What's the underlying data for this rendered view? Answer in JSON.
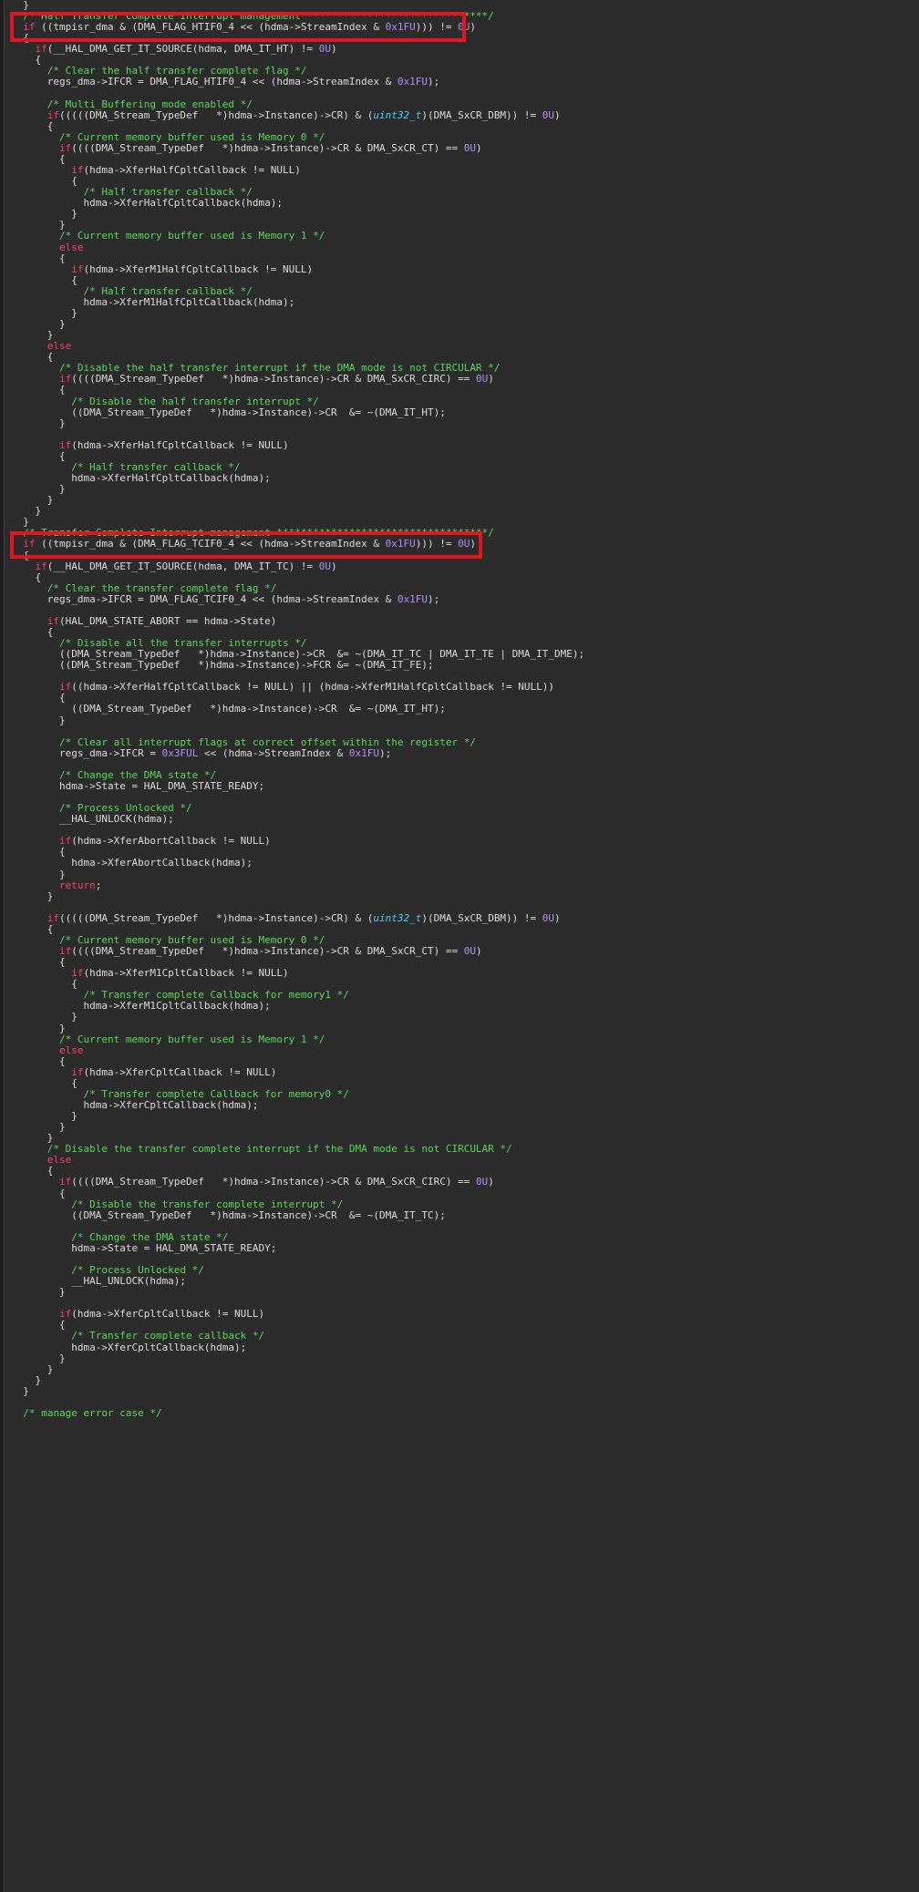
{
  "editor": {
    "highlight_color": "#e0151f",
    "colors": {
      "comment": "#57d957",
      "keyword": "#ff3b6b",
      "number": "#b48cf7",
      "type": "#4fc6ff",
      "default": "#dcdcdc",
      "background": "#2b2b2b"
    },
    "lines": [
      [
        [
          "d",
          "  }"
        ]
      ],
      [
        [
          "c",
          "  /* Half Transfer Complete Interrupt management ******************************/"
        ]
      ],
      [
        [
          "k",
          "  if"
        ],
        [
          "d",
          " ((tmpisr_dma & (DMA_FLAG_HTIF0_4 << (hdma->StreamIndex & "
        ],
        [
          "n",
          "0x1FU"
        ],
        [
          "d",
          "))) != "
        ],
        [
          "n",
          "0U"
        ],
        [
          "d",
          ")"
        ]
      ],
      [
        [
          "d",
          "  {"
        ]
      ],
      [
        [
          "k",
          "    if"
        ],
        [
          "d",
          "(__HAL_DMA_GET_IT_SOURCE(hdma, DMA_IT_HT) != "
        ],
        [
          "n",
          "0U"
        ],
        [
          "d",
          ")"
        ]
      ],
      [
        [
          "d",
          "    {"
        ]
      ],
      [
        [
          "c",
          "      /* Clear the half transfer complete flag */"
        ]
      ],
      [
        [
          "d",
          "      regs_dma->IFCR = DMA_FLAG_HTIF0_4 << (hdma->StreamIndex & "
        ],
        [
          "n",
          "0x1FU"
        ],
        [
          "d",
          ");"
        ]
      ],
      [],
      [
        [
          "c",
          "      /* Multi_Buffering mode enabled */"
        ]
      ],
      [
        [
          "k",
          "      if"
        ],
        [
          "d",
          "(((((DMA_Stream_TypeDef   *)hdma->Instance)->CR) & ("
        ],
        [
          "t",
          "uint32_t"
        ],
        [
          "d",
          ")(DMA_SxCR_DBM)) != "
        ],
        [
          "n",
          "0U"
        ],
        [
          "d",
          ")"
        ]
      ],
      [
        [
          "d",
          "      {"
        ]
      ],
      [
        [
          "c",
          "        /* Current memory buffer used is Memory 0 */"
        ]
      ],
      [
        [
          "k",
          "        if"
        ],
        [
          "d",
          "((((DMA_Stream_TypeDef   *)hdma->Instance)->CR & DMA_SxCR_CT) == "
        ],
        [
          "n",
          "0U"
        ],
        [
          "d",
          ")"
        ]
      ],
      [
        [
          "d",
          "        {"
        ]
      ],
      [
        [
          "k",
          "          if"
        ],
        [
          "d",
          "(hdma->XferHalfCpltCallback != NULL)"
        ]
      ],
      [
        [
          "d",
          "          {"
        ]
      ],
      [
        [
          "c",
          "            /* Half transfer callback */"
        ]
      ],
      [
        [
          "d",
          "            hdma->XferHalfCpltCallback(hdma);"
        ]
      ],
      [
        [
          "d",
          "          }"
        ]
      ],
      [
        [
          "d",
          "        }"
        ]
      ],
      [
        [
          "c",
          "        /* Current memory buffer used is Memory 1 */"
        ]
      ],
      [
        [
          "k",
          "        else"
        ]
      ],
      [
        [
          "d",
          "        {"
        ]
      ],
      [
        [
          "k",
          "          if"
        ],
        [
          "d",
          "(hdma->XferM1HalfCpltCallback != NULL)"
        ]
      ],
      [
        [
          "d",
          "          {"
        ]
      ],
      [
        [
          "c",
          "            /* Half transfer callback */"
        ]
      ],
      [
        [
          "d",
          "            hdma->XferM1HalfCpltCallback(hdma);"
        ]
      ],
      [
        [
          "d",
          "          }"
        ]
      ],
      [
        [
          "d",
          "        }"
        ]
      ],
      [
        [
          "d",
          "      }"
        ]
      ],
      [
        [
          "k",
          "      else"
        ]
      ],
      [
        [
          "d",
          "      {"
        ]
      ],
      [
        [
          "c",
          "        /* Disable the half transfer interrupt if the DMA mode is not CIRCULAR */"
        ]
      ],
      [
        [
          "k",
          "        if"
        ],
        [
          "d",
          "((((DMA_Stream_TypeDef   *)hdma->Instance)->CR & DMA_SxCR_CIRC) == "
        ],
        [
          "n",
          "0U"
        ],
        [
          "d",
          ")"
        ]
      ],
      [
        [
          "d",
          "        {"
        ]
      ],
      [
        [
          "c",
          "          /* Disable the half transfer interrupt */"
        ]
      ],
      [
        [
          "d",
          "          ((DMA_Stream_TypeDef   *)hdma->Instance)->CR  &= ~(DMA_IT_HT);"
        ]
      ],
      [
        [
          "d",
          "        }"
        ]
      ],
      [],
      [
        [
          "k",
          "        if"
        ],
        [
          "d",
          "(hdma->XferHalfCpltCallback != NULL)"
        ]
      ],
      [
        [
          "d",
          "        {"
        ]
      ],
      [
        [
          "c",
          "          /* Half transfer callback */"
        ]
      ],
      [
        [
          "d",
          "          hdma->XferHalfCpltCallback(hdma);"
        ]
      ],
      [
        [
          "d",
          "        }"
        ]
      ],
      [
        [
          "d",
          "      }"
        ]
      ],
      [
        [
          "d",
          "    }"
        ]
      ],
      [
        [
          "d",
          "  }"
        ]
      ],
      [
        [
          "c",
          "  /* Transfer Complete Interrupt management ***********************************/"
        ]
      ],
      [
        [
          "k",
          "  if"
        ],
        [
          "d",
          " ((tmpisr_dma & (DMA_FLAG_TCIF0_4 << (hdma->StreamIndex & "
        ],
        [
          "n",
          "0x1FU"
        ],
        [
          "d",
          "))) != "
        ],
        [
          "n",
          "0U"
        ],
        [
          "d",
          ")"
        ]
      ],
      [
        [
          "d",
          "  {"
        ]
      ],
      [
        [
          "k",
          "    if"
        ],
        [
          "d",
          "(__HAL_DMA_GET_IT_SOURCE(hdma, DMA_IT_TC) != "
        ],
        [
          "n",
          "0U"
        ],
        [
          "d",
          ")"
        ]
      ],
      [
        [
          "d",
          "    {"
        ]
      ],
      [
        [
          "c",
          "      /* Clear the transfer complete flag */"
        ]
      ],
      [
        [
          "d",
          "      regs_dma->IFCR = DMA_FLAG_TCIF0_4 << (hdma->StreamIndex & "
        ],
        [
          "n",
          "0x1FU"
        ],
        [
          "d",
          ");"
        ]
      ],
      [],
      [
        [
          "k",
          "      if"
        ],
        [
          "d",
          "(HAL_DMA_STATE_ABORT == hdma->State)"
        ]
      ],
      [
        [
          "d",
          "      {"
        ]
      ],
      [
        [
          "c",
          "        /* Disable all the transfer interrupts */"
        ]
      ],
      [
        [
          "d",
          "        ((DMA_Stream_TypeDef   *)hdma->Instance)->CR  &= ~(DMA_IT_TC | DMA_IT_TE | DMA_IT_DME);"
        ]
      ],
      [
        [
          "d",
          "        ((DMA_Stream_TypeDef   *)hdma->Instance)->FCR &= ~(DMA_IT_FE);"
        ]
      ],
      [],
      [
        [
          "k",
          "        if"
        ],
        [
          "d",
          "((hdma->XferHalfCpltCallback != NULL) || (hdma->XferM1HalfCpltCallback != NULL))"
        ]
      ],
      [
        [
          "d",
          "        {"
        ]
      ],
      [
        [
          "d",
          "          ((DMA_Stream_TypeDef   *)hdma->Instance)->CR  &= ~(DMA_IT_HT);"
        ]
      ],
      [
        [
          "d",
          "        }"
        ]
      ],
      [],
      [
        [
          "c",
          "        /* Clear all interrupt flags at correct offset within the register */"
        ]
      ],
      [
        [
          "d",
          "        regs_dma->IFCR = "
        ],
        [
          "n",
          "0x3FUL"
        ],
        [
          "d",
          " << (hdma->StreamIndex & "
        ],
        [
          "n",
          "0x1FU"
        ],
        [
          "d",
          ");"
        ]
      ],
      [],
      [
        [
          "c",
          "        /* Change the DMA state */"
        ]
      ],
      [
        [
          "d",
          "        hdma->State = HAL_DMA_STATE_READY;"
        ]
      ],
      [],
      [
        [
          "c",
          "        /* Process Unlocked */"
        ]
      ],
      [
        [
          "d",
          "        __HAL_UNLOCK(hdma);"
        ]
      ],
      [],
      [
        [
          "k",
          "        if"
        ],
        [
          "d",
          "(hdma->XferAbortCallback != NULL)"
        ]
      ],
      [
        [
          "d",
          "        {"
        ]
      ],
      [
        [
          "d",
          "          hdma->XferAbortCallback(hdma);"
        ]
      ],
      [
        [
          "d",
          "        }"
        ]
      ],
      [
        [
          "k",
          "        return"
        ],
        [
          "d",
          ";"
        ]
      ],
      [
        [
          "d",
          "      }"
        ]
      ],
      [],
      [
        [
          "k",
          "      if"
        ],
        [
          "d",
          "(((((DMA_Stream_TypeDef   *)hdma->Instance)->CR) & ("
        ],
        [
          "t",
          "uint32_t"
        ],
        [
          "d",
          ")(DMA_SxCR_DBM)) != "
        ],
        [
          "n",
          "0U"
        ],
        [
          "d",
          ")"
        ]
      ],
      [
        [
          "d",
          "      {"
        ]
      ],
      [
        [
          "c",
          "        /* Current memory buffer used is Memory 0 */"
        ]
      ],
      [
        [
          "k",
          "        if"
        ],
        [
          "d",
          "((((DMA_Stream_TypeDef   *)hdma->Instance)->CR & DMA_SxCR_CT) == "
        ],
        [
          "n",
          "0U"
        ],
        [
          "d",
          ")"
        ]
      ],
      [
        [
          "d",
          "        {"
        ]
      ],
      [
        [
          "k",
          "          if"
        ],
        [
          "d",
          "(hdma->XferM1CpltCallback != NULL)"
        ]
      ],
      [
        [
          "d",
          "          {"
        ]
      ],
      [
        [
          "c",
          "            /* Transfer complete Callback for memory1 */"
        ]
      ],
      [
        [
          "d",
          "            hdma->XferM1CpltCallback(hdma);"
        ]
      ],
      [
        [
          "d",
          "          }"
        ]
      ],
      [
        [
          "d",
          "        }"
        ]
      ],
      [
        [
          "c",
          "        /* Current memory buffer used is Memory 1 */"
        ]
      ],
      [
        [
          "k",
          "        else"
        ]
      ],
      [
        [
          "d",
          "        {"
        ]
      ],
      [
        [
          "k",
          "          if"
        ],
        [
          "d",
          "(hdma->XferCpltCallback != NULL)"
        ]
      ],
      [
        [
          "d",
          "          {"
        ]
      ],
      [
        [
          "c",
          "            /* Transfer complete Callback for memory0 */"
        ]
      ],
      [
        [
          "d",
          "            hdma->XferCpltCallback(hdma);"
        ]
      ],
      [
        [
          "d",
          "          }"
        ]
      ],
      [
        [
          "d",
          "        }"
        ]
      ],
      [
        [
          "d",
          "      }"
        ]
      ],
      [
        [
          "c",
          "      /* Disable the transfer complete interrupt if the DMA mode is not CIRCULAR */"
        ]
      ],
      [
        [
          "k",
          "      else"
        ]
      ],
      [
        [
          "d",
          "      {"
        ]
      ],
      [
        [
          "k",
          "        if"
        ],
        [
          "d",
          "((((DMA_Stream_TypeDef   *)hdma->Instance)->CR & DMA_SxCR_CIRC) == "
        ],
        [
          "n",
          "0U"
        ],
        [
          "d",
          ")"
        ]
      ],
      [
        [
          "d",
          "        {"
        ]
      ],
      [
        [
          "c",
          "          /* Disable the transfer complete interrupt */"
        ]
      ],
      [
        [
          "d",
          "          ((DMA_Stream_TypeDef   *)hdma->Instance)->CR  &= ~(DMA_IT_TC);"
        ]
      ],
      [],
      [
        [
          "c",
          "          /* Change the DMA state */"
        ]
      ],
      [
        [
          "d",
          "          hdma->State = HAL_DMA_STATE_READY;"
        ]
      ],
      [],
      [
        [
          "c",
          "          /* Process Unlocked */"
        ]
      ],
      [
        [
          "d",
          "          __HAL_UNLOCK(hdma);"
        ]
      ],
      [
        [
          "d",
          "        }"
        ]
      ],
      [],
      [
        [
          "k",
          "        if"
        ],
        [
          "d",
          "(hdma->XferCpltCallback != NULL)"
        ]
      ],
      [
        [
          "d",
          "        {"
        ]
      ],
      [
        [
          "c",
          "          /* Transfer complete callback */"
        ]
      ],
      [
        [
          "d",
          "          hdma->XferCpltCallback(hdma);"
        ]
      ],
      [
        [
          "d",
          "        }"
        ]
      ],
      [
        [
          "d",
          "      }"
        ]
      ],
      [
        [
          "d",
          "    }"
        ]
      ],
      [
        [
          "d",
          "  }"
        ]
      ],
      [],
      [
        [
          "c",
          "  /* manage error case */"
        ]
      ]
    ]
  }
}
